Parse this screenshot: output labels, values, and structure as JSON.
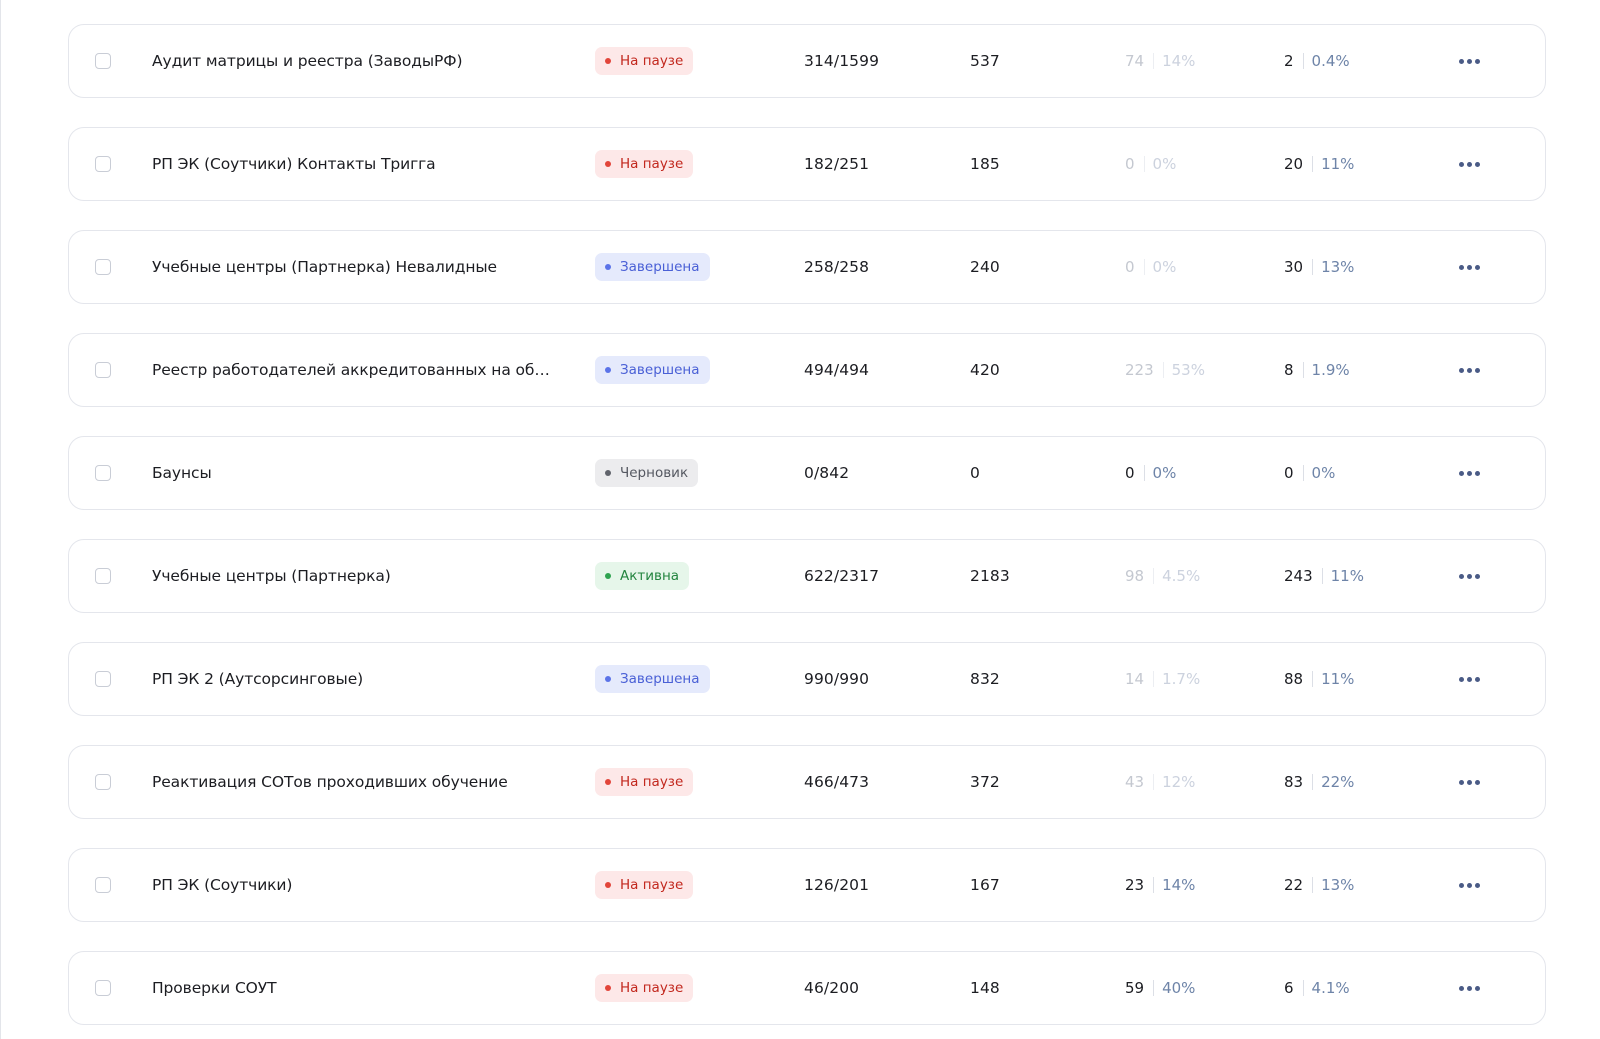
{
  "rows": [
    {
      "name": "Аудит матрицы и реестра (ЗаводыРФ)",
      "status": {
        "label": "На паузе",
        "kind": "pause"
      },
      "progress": "314/1599",
      "count": "537",
      "metric_a": {
        "value": "74",
        "percent": "14%",
        "style": "dim"
      },
      "metric_b": {
        "value": "2",
        "percent": "0.4%",
        "style": "strong"
      }
    },
    {
      "name": "РП ЭК (Соутчики) Контакты Тригга",
      "status": {
        "label": "На паузе",
        "kind": "pause"
      },
      "progress": "182/251",
      "count": "185",
      "metric_a": {
        "value": "0",
        "percent": "0%",
        "style": "dim"
      },
      "metric_b": {
        "value": "20",
        "percent": "11%",
        "style": "strong"
      }
    },
    {
      "name": "Учебные центры (Партнерка) Невалидные",
      "status": {
        "label": "Завершена",
        "kind": "done"
      },
      "progress": "258/258",
      "count": "240",
      "metric_a": {
        "value": "0",
        "percent": "0%",
        "style": "dim"
      },
      "metric_b": {
        "value": "30",
        "percent": "13%",
        "style": "strong"
      }
    },
    {
      "name": "Реестр работодателей аккредитованных на обучение",
      "status": {
        "label": "Завершена",
        "kind": "done"
      },
      "progress": "494/494",
      "count": "420",
      "metric_a": {
        "value": "223",
        "percent": "53%",
        "style": "dim"
      },
      "metric_b": {
        "value": "8",
        "percent": "1.9%",
        "style": "strong"
      }
    },
    {
      "name": "Баунсы",
      "status": {
        "label": "Черновик",
        "kind": "draft"
      },
      "progress": "0/842",
      "count": "0",
      "metric_a": {
        "value": "0",
        "percent": "0%",
        "style": "strong"
      },
      "metric_b": {
        "value": "0",
        "percent": "0%",
        "style": "strong"
      }
    },
    {
      "name": "Учебные центры (Партнерка)",
      "status": {
        "label": "Активна",
        "kind": "active"
      },
      "progress": "622/2317",
      "count": "2183",
      "metric_a": {
        "value": "98",
        "percent": "4.5%",
        "style": "dim"
      },
      "metric_b": {
        "value": "243",
        "percent": "11%",
        "style": "strong"
      }
    },
    {
      "name": "РП ЭК 2 (Аутсорсинговые)",
      "status": {
        "label": "Завершена",
        "kind": "done"
      },
      "progress": "990/990",
      "count": "832",
      "metric_a": {
        "value": "14",
        "percent": "1.7%",
        "style": "dim"
      },
      "metric_b": {
        "value": "88",
        "percent": "11%",
        "style": "strong"
      }
    },
    {
      "name": "Реактивация СОТов проходивших обучение",
      "status": {
        "label": "На паузе",
        "kind": "pause"
      },
      "progress": "466/473",
      "count": "372",
      "metric_a": {
        "value": "43",
        "percent": "12%",
        "style": "dim"
      },
      "metric_b": {
        "value": "83",
        "percent": "22%",
        "style": "strong"
      }
    },
    {
      "name": "РП ЭК (Соутчики)",
      "status": {
        "label": "На паузе",
        "kind": "pause"
      },
      "progress": "126/201",
      "count": "167",
      "metric_a": {
        "value": "23",
        "percent": "14%",
        "style": "strong"
      },
      "metric_b": {
        "value": "22",
        "percent": "13%",
        "style": "strong"
      }
    },
    {
      "name": "Проверки СОУТ",
      "status": {
        "label": "На паузе",
        "kind": "pause"
      },
      "progress": "46/200",
      "count": "148",
      "metric_a": {
        "value": "59",
        "percent": "40%",
        "style": "strong"
      },
      "metric_b": {
        "value": "6",
        "percent": "4.1%",
        "style": "strong"
      }
    }
  ],
  "icons": {
    "checkbox": "checkbox-icon",
    "more": "more-horizontal-icon",
    "status_dot": "dot-icon"
  },
  "colors": {
    "pause": "#c2281e",
    "done": "#4a60d6",
    "draft": "#555861",
    "active": "#23843f",
    "percent": "#6e84a8",
    "more_icon": "#4a5b86"
  }
}
